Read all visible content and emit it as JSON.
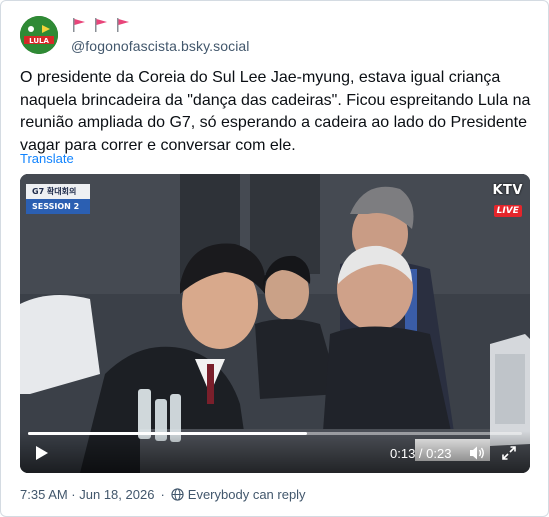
{
  "post": {
    "handle": "@fogonofascista.bsky.social",
    "avatar_text": "LULA",
    "flag_count": 3,
    "text": "O presidente da Coreia do Sul Lee Jae-myung, estava igual criança naquela brincadeira da \"dança das cadeiras\". Ficou espreitando Lula na reunião ampliada do G7, só esperando a cadeira ao lado do Presidente vagar para correr e conversar com ele.",
    "translate_label": "Translate"
  },
  "video": {
    "overlay_top": "G7 확대회의",
    "overlay_bottom": "SESSION 2",
    "channel": "KTV",
    "live_label": "LIVE",
    "time": "0:13 / 0:23",
    "progress": 0.565,
    "icons": {
      "play": "play-icon",
      "mute": "volume-icon",
      "fullscreen": "fullscreen-icon"
    }
  },
  "footer": {
    "timestamp": "7:35 AM · Jun 18, 2026",
    "separator": "·",
    "reply_setting": "Everybody can reply"
  },
  "colors": {
    "link": "#1083fe",
    "muted": "#42576c",
    "flag": "#e8457a",
    "live": "#e5252b"
  }
}
